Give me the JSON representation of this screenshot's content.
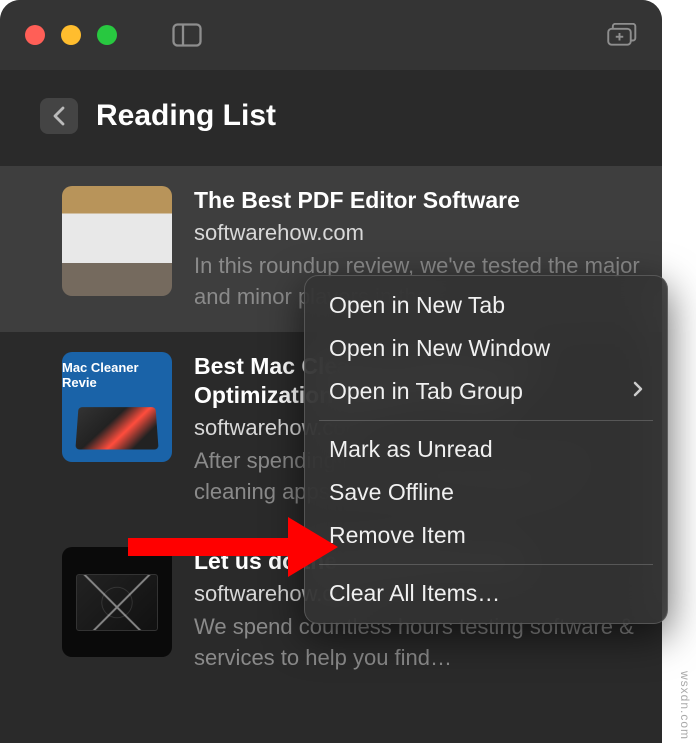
{
  "header": {
    "title": "Reading List"
  },
  "items": [
    {
      "title": "The Best PDF Editor Software",
      "domain": "softwarehow.com",
      "desc": "In this roundup review, we've tested the major and minor players in the…",
      "thumbLabel": ""
    },
    {
      "title": "Best Mac Cleaner Software and Optimization Utilities of 2022",
      "domain": "softwarehow.com",
      "desc": "After spending hours testing several Mac cleaning apps, we vote CleanMyMac X…",
      "thumbLabel": "Mac Cleaner Revie"
    },
    {
      "title": "Let us do the research for you.",
      "domain": "softwarehow.com",
      "desc": "We spend countless hours testing software & services to help you find…",
      "thumbLabel": ""
    }
  ],
  "menu": {
    "openNewTab": "Open in New Tab",
    "openNewWindow": "Open in New Window",
    "openTabGroup": "Open in Tab Group",
    "markUnread": "Mark as Unread",
    "saveOffline": "Save Offline",
    "removeItem": "Remove Item",
    "clearAll": "Clear All Items…"
  },
  "watermark": "wsxdn.com"
}
